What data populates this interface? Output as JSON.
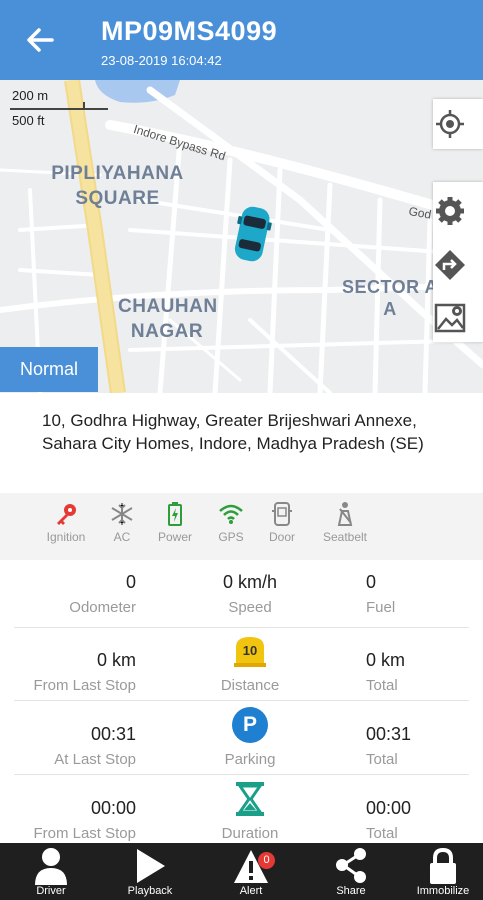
{
  "header": {
    "title": "MP09MS4099",
    "timestamp": "23-08-2019 16:04:42",
    "bg_color": "#4a90d9"
  },
  "map": {
    "scale_metric": "200 m",
    "scale_imperial": "500 ft",
    "labels": {
      "pipliyahana": "PIPLIYAHANA\nSQUARE",
      "chauhan": "CHAUHAN\nNAGAR",
      "sector": "SECTOR A\nA"
    },
    "roads": {
      "indore_bypass": "Indore Bypass Rd",
      "god": "God"
    },
    "mode_button": "Normal"
  },
  "address": "10, Godhra Highway, Greater Brijeshwari Annexe, Sahara City Homes, Indore, Madhya Pradesh (SE)",
  "status": [
    {
      "label": "Ignition",
      "icon": "key-icon",
      "color": "#e53935"
    },
    {
      "label": "AC",
      "icon": "snowflake-icon",
      "color": "#9e9e9e"
    },
    {
      "label": "Power",
      "icon": "battery-icon",
      "color": "#2e9e3a"
    },
    {
      "label": "GPS",
      "icon": "wifi-icon",
      "color": "#2e9e3a"
    },
    {
      "label": "Door",
      "icon": "door-icon",
      "color": "#9e9e9e"
    },
    {
      "label": "Seatbelt",
      "icon": "seatbelt-icon",
      "color": "#9e9e9e"
    }
  ],
  "stats": {
    "odometer": {
      "value": "0",
      "label": "Odometer"
    },
    "speed": {
      "value": "0 km/h",
      "label": "Speed"
    },
    "fuel": {
      "value": "0",
      "label": "Fuel"
    },
    "from_last_stop_distance": {
      "value": "0 km",
      "label": "From Last Stop"
    },
    "distance": {
      "label": "Distance",
      "icon_text": "10"
    },
    "total_distance": {
      "value": "0 km",
      "label": "Total"
    },
    "at_last_stop": {
      "value": "00:31",
      "label": "At Last Stop"
    },
    "parking": {
      "label": "Parking",
      "icon_text": "P"
    },
    "total_parking": {
      "value": "00:31",
      "label": "Total"
    },
    "from_last_stop_duration": {
      "value": "00:00",
      "label": "From Last Stop"
    },
    "duration": {
      "label": "Duration"
    },
    "total_duration": {
      "value": "00:00",
      "label": "Total"
    }
  },
  "nav": {
    "driver": "Driver",
    "playback": "Playback",
    "alert": "Alert",
    "alert_badge": "0",
    "share": "Share",
    "immobilize": "Immobilize"
  }
}
